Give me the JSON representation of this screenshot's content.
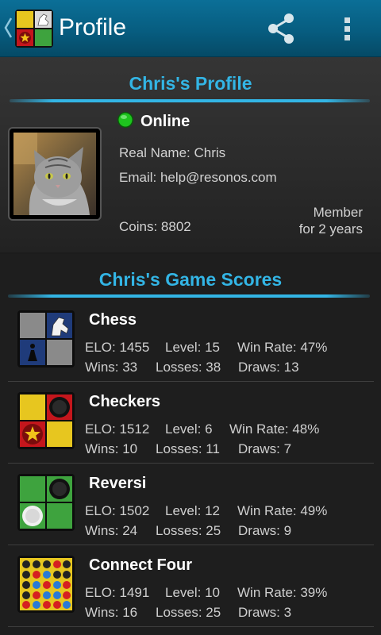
{
  "actionbar": {
    "title": "Profile",
    "icons": [
      "back-caret-icon",
      "app-logo-icon",
      "share-icon",
      "overflow-menu-icon"
    ]
  },
  "profile": {
    "title": "Chris's Profile",
    "status": "Online",
    "status_color": "#1ec41e",
    "real_name": "Real Name: Chris",
    "email": "Email: help@resonos.com",
    "coins": "Coins: 8802",
    "member_line1": "Member",
    "member_line2": "for 2 years"
  },
  "scores": {
    "title": "Chris's Game Scores",
    "games": [
      {
        "name": "Chess",
        "elo": "ELO: 1455",
        "level": "Level: 15",
        "win_rate": "Win Rate: 47%",
        "wins": "Wins: 33",
        "losses": "Losses: 38",
        "draws": "Draws: 13"
      },
      {
        "name": "Checkers",
        "elo": "ELO: 1512",
        "level": "Level: 6",
        "win_rate": "Win Rate: 48%",
        "wins": "Wins: 10",
        "losses": "Losses: 11",
        "draws": "Draws: 7"
      },
      {
        "name": "Reversi",
        "elo": "ELO: 1502",
        "level": "Level: 12",
        "win_rate": "Win Rate: 49%",
        "wins": "Wins: 24",
        "losses": "Losses: 25",
        "draws": "Draws: 9"
      },
      {
        "name": "Connect Four",
        "elo": "ELO: 1491",
        "level": "Level: 10",
        "win_rate": "Win Rate: 39%",
        "wins": "Wins: 16",
        "losses": "Losses: 25",
        "draws": "Draws: 3"
      }
    ]
  },
  "colors": {
    "accent": "#33b5e5",
    "actionbar": "#075d80"
  }
}
